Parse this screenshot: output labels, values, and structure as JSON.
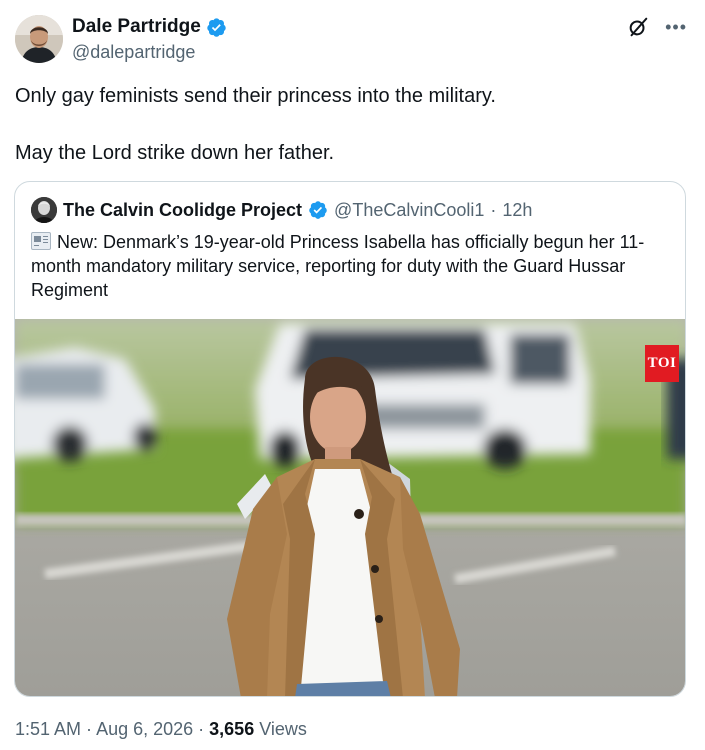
{
  "author": {
    "name": "Dale Partridge",
    "handle": "@dalepartridge",
    "verified": true
  },
  "tweet": {
    "line1": "Only gay feminists send their princess into the military.",
    "line2": "May the Lord strike down her father."
  },
  "quote": {
    "name": "The Calvin Coolidge Project",
    "handle": "@TheCalvinCooli1",
    "separator": "·",
    "time": "12h",
    "emoji_icon": "newspaper-icon",
    "text": "New: Denmark’s 19-year-old Princess Isabella has officially begun her 11-month mandatory military service, reporting for duty with the Guard Hussar Regiment",
    "image_badge": "TOI"
  },
  "meta": {
    "time": "1:51 AM",
    "sep1": " · ",
    "date": "Aug 6, 2026",
    "sep2": " · ",
    "views_count": "3,656",
    "views_label": "Views"
  },
  "colors": {
    "verified": "#1d9bf0",
    "secondary_text": "#536471",
    "border": "#cfd9de",
    "badge": "#e11b22"
  }
}
